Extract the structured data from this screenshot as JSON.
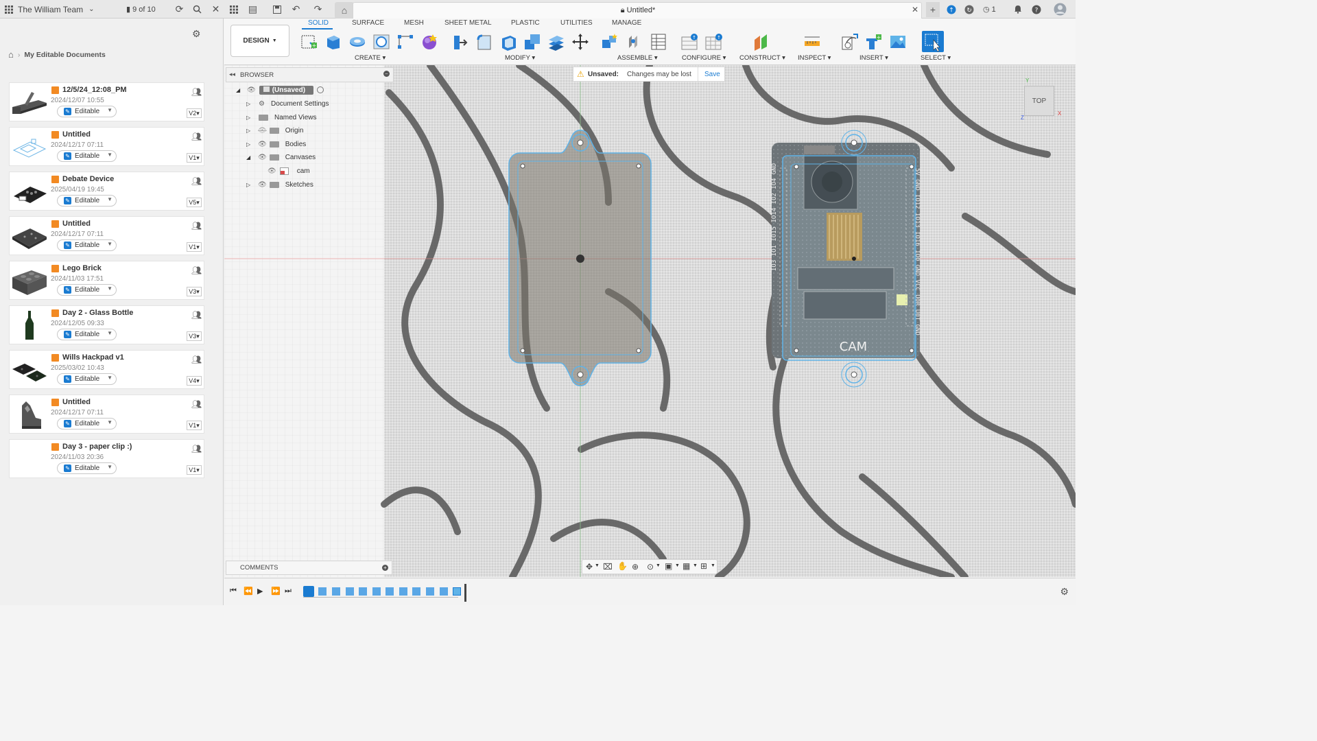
{
  "topbar": {
    "team_name": "The William Team",
    "doc_counter": "9 of 10",
    "doc_title": "Untitled*",
    "notifications_count": "1"
  },
  "left_panel": {
    "breadcrumb": "My Editable Documents",
    "documents": [
      {
        "name": "12/5/24_12:08_PM",
        "date": "2024/12/07 10:55",
        "status": "Editable",
        "version": "V2"
      },
      {
        "name": "Untitled",
        "date": "2024/12/17 07:11",
        "status": "Editable",
        "version": "V1"
      },
      {
        "name": "Debate Device",
        "date": "2025/04/19 19:45",
        "status": "Editable",
        "version": "V5"
      },
      {
        "name": "Untitled",
        "date": "2024/12/17 07:11",
        "status": "Editable",
        "version": "V1"
      },
      {
        "name": "Lego Brick",
        "date": "2024/11/03 17:51",
        "status": "Editable",
        "version": "V3"
      },
      {
        "name": "Day 2 - Glass Bottle",
        "date": "2024/12/05 09:33",
        "status": "Editable",
        "version": "V3"
      },
      {
        "name": "Wills Hackpad v1",
        "date": "2025/03/02 10:43",
        "status": "Editable",
        "version": "V4"
      },
      {
        "name": "Untitled",
        "date": "2024/12/17 07:11",
        "status": "Editable",
        "version": "V1"
      },
      {
        "name": "Day 3 - paper clip :)",
        "date": "2024/11/03 20:36",
        "status": "Editable",
        "version": "V1"
      }
    ]
  },
  "toolbar": {
    "workspace": "DESIGN",
    "tabs": [
      "SOLID",
      "SURFACE",
      "MESH",
      "SHEET METAL",
      "PLASTIC",
      "UTILITIES",
      "MANAGE"
    ],
    "active_tab": "SOLID",
    "groups": {
      "create": "CREATE",
      "modify": "MODIFY",
      "assemble": "ASSEMBLE",
      "configure": "CONFIGURE",
      "construct": "CONSTRUCT",
      "inspect": "INSPECT",
      "insert": "INSERT",
      "select": "SELECT"
    }
  },
  "browser": {
    "title": "BROWSER",
    "root": "(Unsaved)",
    "items": [
      "Document Settings",
      "Named Views",
      "Origin",
      "Bodies",
      "Canvases",
      "cam",
      "Sketches"
    ]
  },
  "unsaved_bar": {
    "label": "Unsaved:",
    "message": "Changes may be lost",
    "save": "Save"
  },
  "viewcube": {
    "face": "TOP"
  },
  "comments": {
    "title": "COMMENTS"
  },
  "board": {
    "pin_labels_left": "IO3 IO1 IO15 IO14 IO2 IO4 GND",
    "pin_labels_right": "5V GND IO12 IO13 IO16 IO0 GND VCC U0R U0T GND",
    "brand": "CAM"
  },
  "colors": {
    "accent": "#1a7bd1",
    "cube_orange": "#f28a23",
    "sketch_blue": "#5fb3e8"
  },
  "icons": [
    "apps-icon",
    "doc-count-icon",
    "refresh-icon",
    "search-icon",
    "close-icon",
    "grid-icon",
    "file-icon",
    "save-icon",
    "undo-icon",
    "redo-icon",
    "home-icon",
    "lock-icon",
    "plus-icon",
    "extension-icon",
    "sync-icon",
    "clock-icon",
    "bell-icon",
    "help-icon",
    "avatar-icon",
    "gear-icon"
  ]
}
